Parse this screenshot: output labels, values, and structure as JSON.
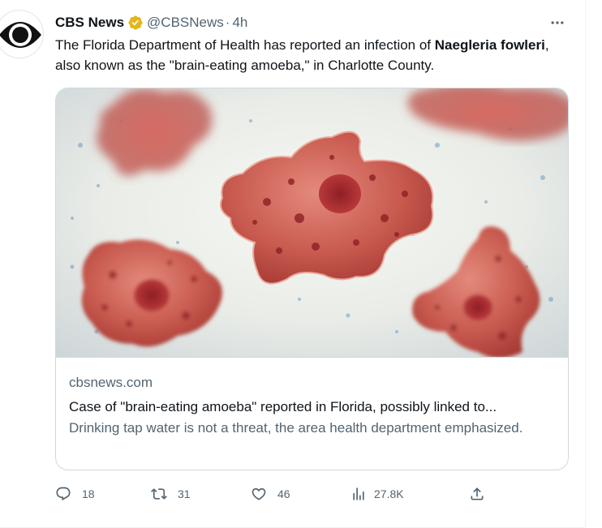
{
  "author": {
    "display_name": "CBS News",
    "handle": "@CBSNews",
    "separator": "·",
    "time": "4h",
    "verified_badge_color": "#e2b719",
    "avatar_icon": "cbs-eye-logo"
  },
  "tweet": {
    "text_before": "The Florida Department of Health has reported an infection of ",
    "text_bold": "Naegleria fowleri",
    "text_after": ", also known as the \"brain-eating amoeba,\" in Charlotte County."
  },
  "card": {
    "domain": "cbsnews.com",
    "title": "Case of \"brain-eating amoeba\" reported in Florida, possibly linked to...",
    "description": "Drinking tap water is not a threat, the area health department emphasized.",
    "image_subject": "microscopic amoeba illustration"
  },
  "actions": {
    "replies": "18",
    "retweets": "31",
    "likes": "46",
    "views": "27.8K",
    "reply_icon": "reply-icon",
    "retweet_icon": "retweet-icon",
    "like_icon": "heart-icon",
    "views_icon": "analytics-icon",
    "share_icon": "share-icon"
  },
  "colors": {
    "text_primary": "#0f1419",
    "text_secondary": "#536471",
    "border": "#cfd9de"
  }
}
